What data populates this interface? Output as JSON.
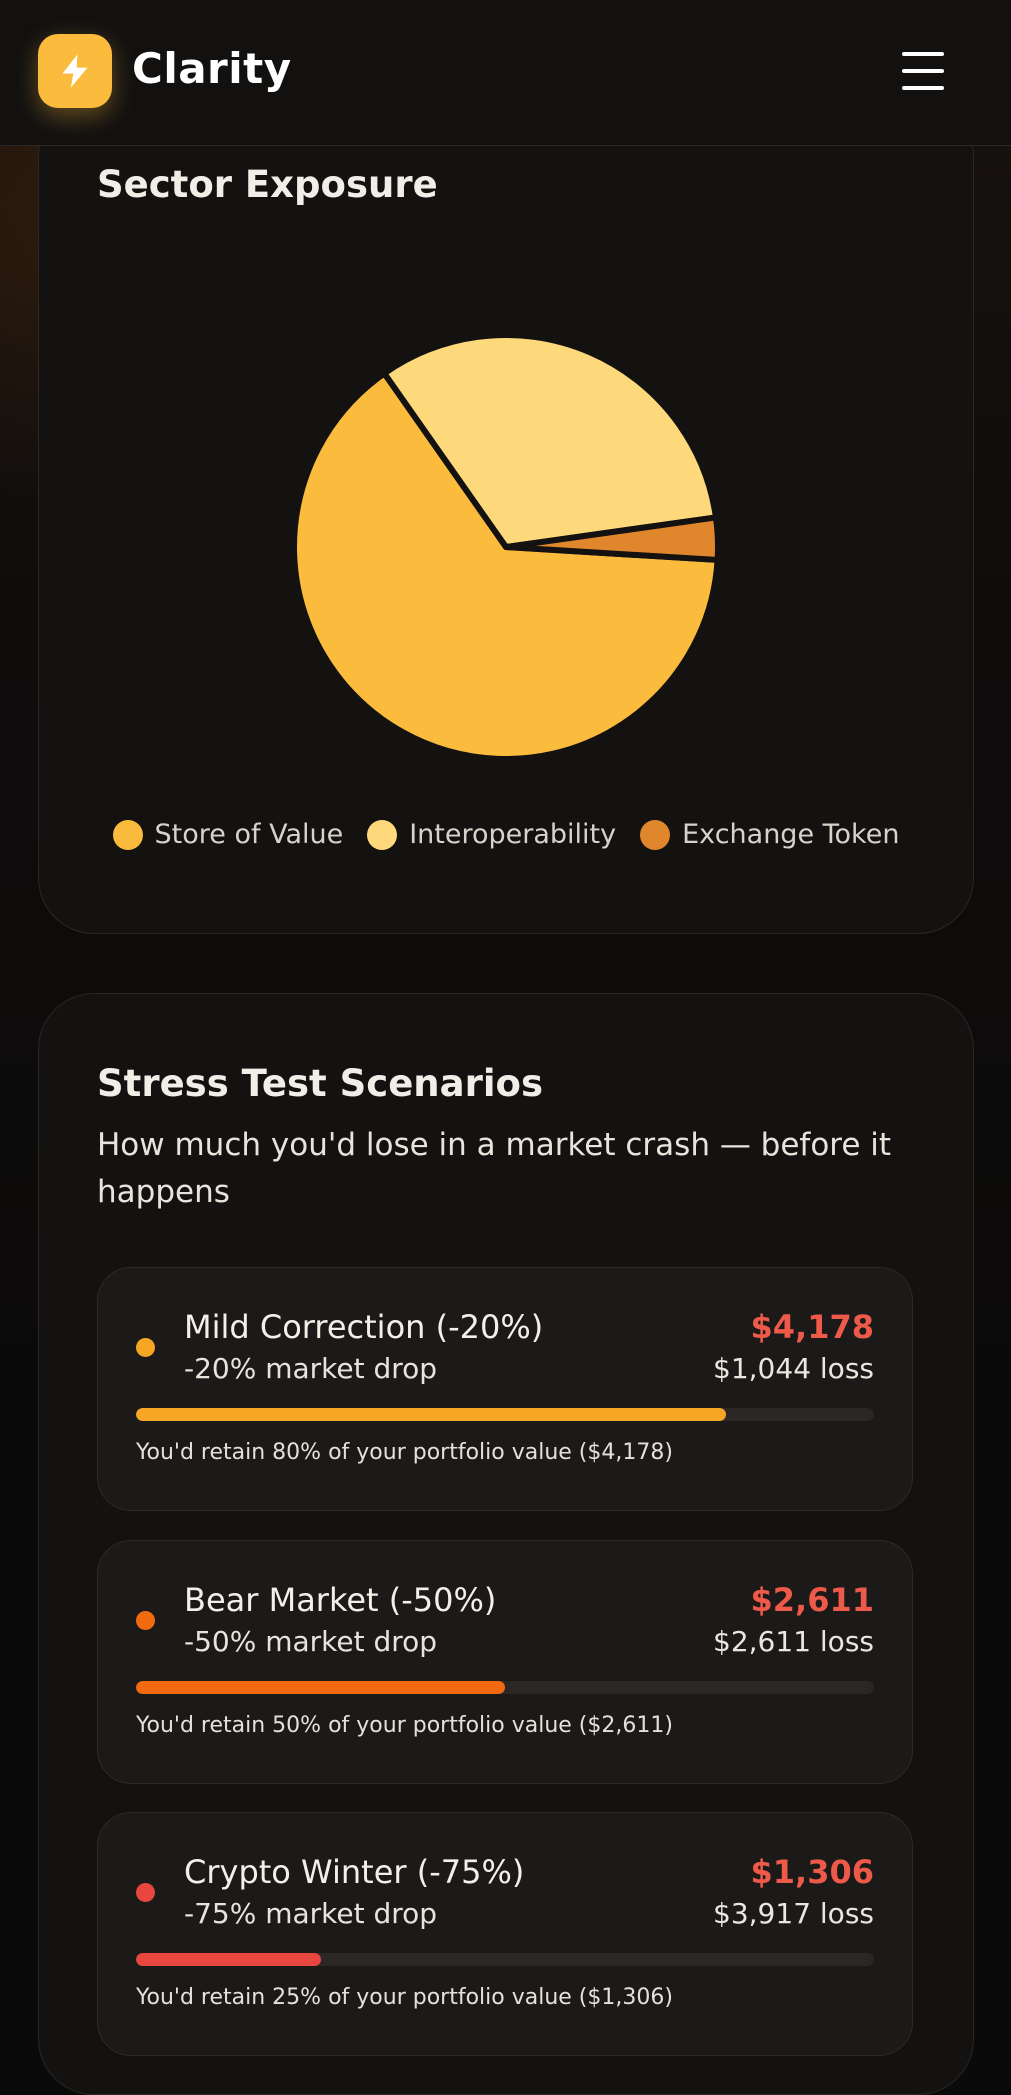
{
  "app": {
    "name": "Clarity"
  },
  "sector": {
    "title": "Sector Exposure",
    "chart_data": {
      "type": "pie",
      "categories": [
        "Store of Value",
        "Interoperability",
        "Exchange Token"
      ],
      "values": [
        64.3,
        32.5,
        3.2
      ],
      "colors": [
        "#fbbb3c",
        "#fdd97c",
        "#e0862c"
      ],
      "legend": "bottom"
    }
  },
  "stress": {
    "title": "Stress Test Scenarios",
    "subtitle": "How much you'd lose in a market crash — before it happens",
    "scenarios": [
      {
        "name": "Mild Correction (-20%)",
        "drop": "-20% market drop",
        "value": "$4,178",
        "loss": "$1,044 loss",
        "retain_percent": 80,
        "note": "You'd retain 80% of your portfolio value ($4,178)",
        "color": "#f6a623"
      },
      {
        "name": "Bear Market (-50%)",
        "drop": "-50% market drop",
        "value": "$2,611",
        "loss": "$2,611 loss",
        "retain_percent": 50,
        "note": "You'd retain 50% of your portfolio value ($2,611)",
        "color": "#f26a10"
      },
      {
        "name": "Crypto Winter (-75%)",
        "drop": "-75% market drop",
        "value": "$1,306",
        "loss": "$3,917 loss",
        "retain_percent": 25,
        "note": "You'd retain 25% of your portfolio value ($1,306)",
        "color": "#e8463e"
      }
    ]
  }
}
